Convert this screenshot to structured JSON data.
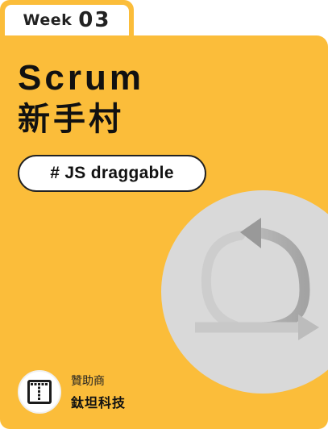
{
  "week": {
    "label": "Week",
    "number": "03"
  },
  "title": {
    "line1": "Scrum",
    "line2": "新手村"
  },
  "tag": {
    "text": "# JS draggable"
  },
  "sponsor": {
    "label": "贊助商",
    "name": "鈦坦科技",
    "logo_icon": "titansoft-logo-icon"
  },
  "illustration": {
    "icon": "cycle-arrow-icon"
  },
  "colors": {
    "background": "#fbbd3a",
    "circle": "#d9d9d9",
    "arrow": "#9b9b9b",
    "text": "#111111"
  }
}
